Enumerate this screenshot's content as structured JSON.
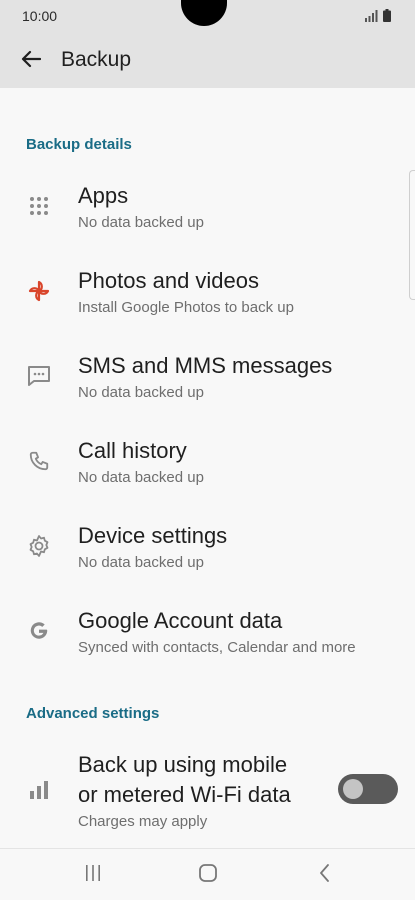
{
  "status": {
    "time": "10:00"
  },
  "app_bar": {
    "title": "Backup"
  },
  "sections": {
    "backup_details": "Backup details",
    "advanced_settings": "Advanced settings"
  },
  "items": [
    {
      "title": "Apps",
      "subtitle": "No data backed up",
      "icon": "apps-grid-icon"
    },
    {
      "title": "Photos and videos",
      "subtitle": "Install Google Photos to back up",
      "icon": "pinwheel-icon"
    },
    {
      "title": "SMS and MMS messages",
      "subtitle": "No data backed up",
      "icon": "message-icon"
    },
    {
      "title": "Call history",
      "subtitle": "No data backed up",
      "icon": "phone-icon"
    },
    {
      "title": "Device settings",
      "subtitle": "No data backed up",
      "icon": "gear-icon"
    },
    {
      "title": "Google Account data",
      "subtitle": "Synced with contacts, Calendar and more",
      "icon": "google-g-icon"
    }
  ],
  "advanced": {
    "mobile_data": {
      "title_line1": "Back up using mobile",
      "title_line2": "or metered Wi-Fi data",
      "subtitle": "Charges may apply",
      "enabled": false
    }
  },
  "colors": {
    "accent": "#1a6c86",
    "photos_icon": "#d9452b"
  }
}
